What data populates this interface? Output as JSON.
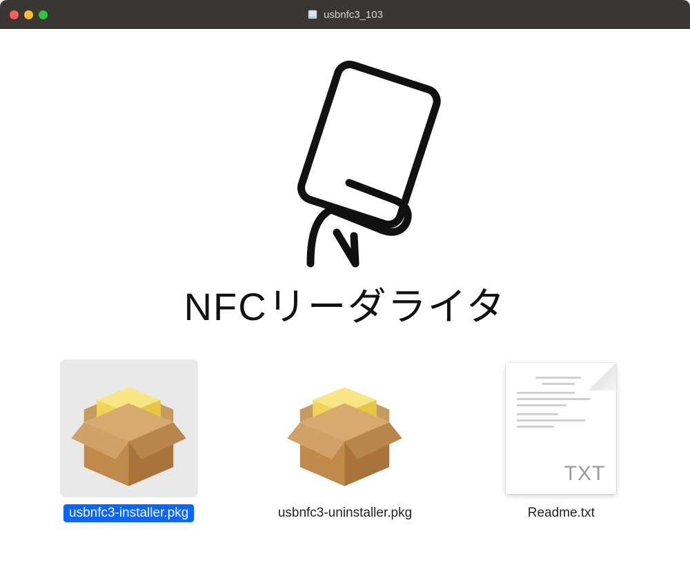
{
  "window": {
    "title": "usbnfc3_103",
    "title_icon": "disk-icon"
  },
  "logo": {
    "text": "NFCリーダライタ"
  },
  "files": [
    {
      "name": "usbnfc3-installer.pkg",
      "icon": "pkg-icon",
      "selected": true
    },
    {
      "name": "usbnfc3-uninstaller.pkg",
      "icon": "pkg-icon",
      "selected": false
    },
    {
      "name": "Readme.txt",
      "icon": "txt-icon",
      "ext_label": "TXT",
      "selected": false
    }
  ]
}
